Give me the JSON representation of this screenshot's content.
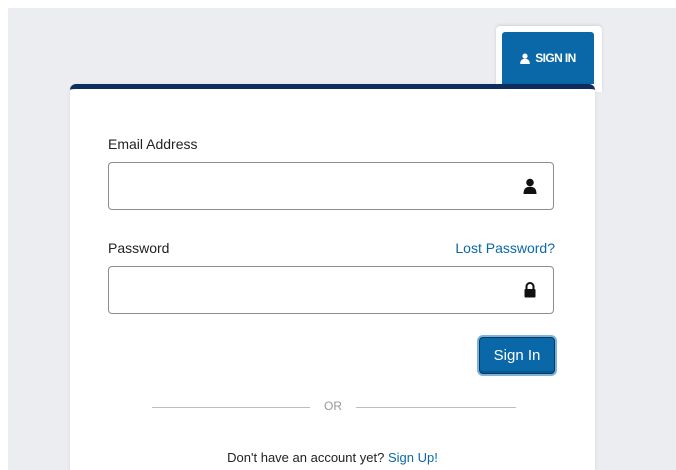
{
  "tab": {
    "label": "SIGN IN",
    "icon": "user-icon"
  },
  "form": {
    "email": {
      "label": "Email Address",
      "value": "",
      "placeholder": "",
      "icon": "user-icon"
    },
    "password": {
      "label": "Password",
      "value": "",
      "placeholder": "",
      "icon": "lock-icon",
      "lost_link": "Lost Password?"
    },
    "submit_label": "Sign In",
    "divider_text": "OR",
    "signup_prompt": "Don't have an account yet?",
    "signup_link": "Sign Up!"
  },
  "colors": {
    "primary": "#0a68a8",
    "header_bar": "#0c2d5e",
    "background": "#ecedf1"
  }
}
